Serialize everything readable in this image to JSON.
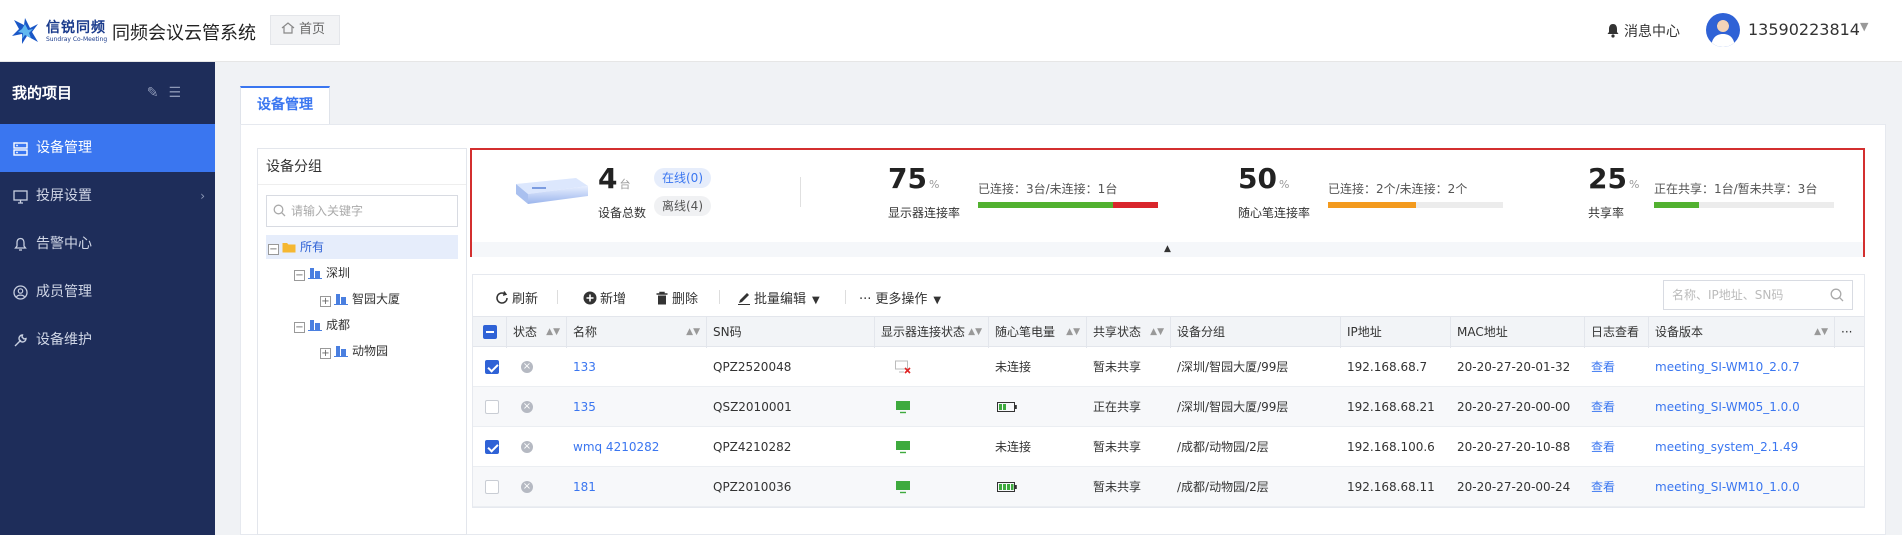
{
  "brand": {
    "logo_text": "信锐同频",
    "logo_sub": "Sundray Co-Meeting",
    "system_title": "同频会议云管系统",
    "home_tab": "首页"
  },
  "header": {
    "messages": "消息中心",
    "username": "13590223814"
  },
  "sidebar": {
    "title": "我的项目",
    "items": [
      {
        "label": "设备管理",
        "icon": "device-icon",
        "active": true
      },
      {
        "label": "投屏设置",
        "icon": "screen-cast-icon",
        "has_arrow": true
      },
      {
        "label": "告警中心",
        "icon": "bell-icon"
      },
      {
        "label": "成员管理",
        "icon": "user-icon"
      },
      {
        "label": "设备维护",
        "icon": "wrench-icon"
      }
    ]
  },
  "main": {
    "tab": "设备管理"
  },
  "groups": {
    "title": "设备分组",
    "search_placeholder": "请输入关键字",
    "tree": {
      "root": "所有",
      "shenzhen": "深圳",
      "zhiyuan": "智园大厦",
      "chengdu": "成都",
      "zoo": "动物园"
    }
  },
  "stats": {
    "total": {
      "value": "4",
      "unit": "台",
      "label": "设备总数",
      "online": "在线(0)",
      "offline": "离线(4)"
    },
    "display": {
      "value": "75",
      "unit": "%",
      "label": "显示器连接率",
      "caption": "已连接：3台/未连接：1台",
      "connected_fraction": 0.75
    },
    "pen": {
      "value": "50",
      "unit": "%",
      "label": "随心笔连接率",
      "caption": "已连接：2个/未连接：2个",
      "connected_fraction": 0.5
    },
    "share": {
      "value": "25",
      "unit": "%",
      "label": "共享率",
      "caption": "正在共享：1台/暂未共享：3台",
      "sharing_fraction": 0.25
    },
    "colors": {
      "green": "#52b130",
      "red": "#d9262c",
      "orange": "#f39a1e"
    }
  },
  "toolbar": {
    "refresh": "刷新",
    "add": "新增",
    "delete": "删除",
    "batch_edit": "批量编辑",
    "more": "更多操作",
    "search_placeholder": "名称、IP地址、SN码"
  },
  "table": {
    "headers": {
      "status": "状态",
      "name": "名称",
      "sn": "SN码",
      "display": "显示器连接状态",
      "pen": "随心笔电量",
      "share": "共享状态",
      "group": "设备分组",
      "ip": "IP地址",
      "mac": "MAC地址",
      "log": "日志查看",
      "version": "设备版本",
      "more": "···"
    },
    "rows": [
      {
        "checked": true,
        "name": "133",
        "sn": "QPZ2520048",
        "display": "disconnected",
        "pen": "未连接",
        "share": "暂未共享",
        "group": "/深圳/智园大厦/99层",
        "ip": "192.168.68.7",
        "mac": "20-20-27-20-01-32",
        "log": "查看",
        "version": "meeting_SI-WM10_2.0.7"
      },
      {
        "checked": false,
        "name": "135",
        "sn": "QSZ2010001",
        "display": "connected",
        "pen": "battery-low",
        "share": "正在共享",
        "group": "/深圳/智园大厦/99层",
        "ip": "192.168.68.21",
        "mac": "20-20-27-20-00-00",
        "log": "查看",
        "version": "meeting_SI-WM05_1.0.0"
      },
      {
        "checked": true,
        "name": "wmq 4210282",
        "sn": "QPZ4210282",
        "display": "connected",
        "pen": "未连接",
        "share": "暂未共享",
        "group": "/成都/动物园/2层",
        "ip": "192.168.100.6",
        "mac": "20-20-27-20-10-88",
        "log": "查看",
        "version": "meeting_system_2.1.49"
      },
      {
        "checked": false,
        "name": "181",
        "sn": "QPZ2010036",
        "display": "connected",
        "pen": "battery-full",
        "share": "暂未共享",
        "group": "/成都/动物园/2层",
        "ip": "192.168.68.11",
        "mac": "20-20-27-20-00-24",
        "log": "查看",
        "version": "meeting_SI-WM10_1.0.0"
      }
    ]
  }
}
